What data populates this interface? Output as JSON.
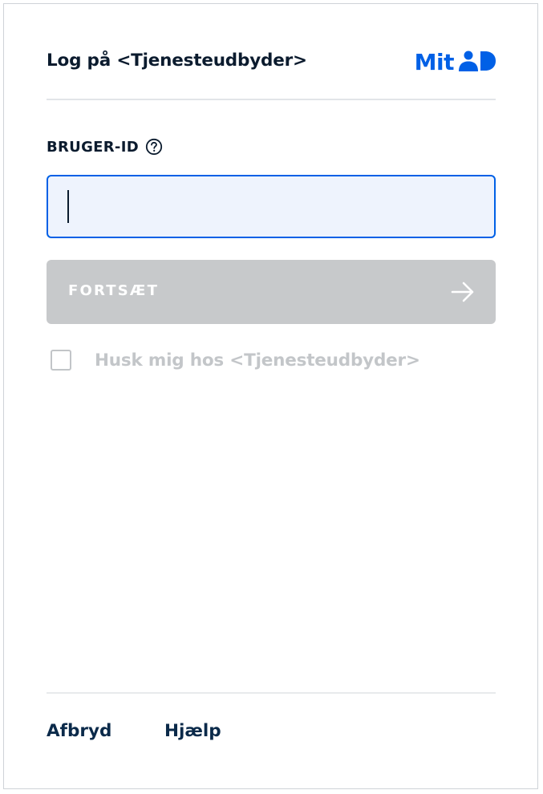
{
  "header": {
    "title": "Log på <Tjenesteudbyder>",
    "logo_text": "Mit",
    "logo_icon": "person-id-icon",
    "brand_color": "#0060e6"
  },
  "form": {
    "field_label": "BRUGER-ID",
    "help_icon": "question-circle-icon",
    "user_id_value": "",
    "continue_label": "FORTSÆT",
    "continue_icon": "arrow-right-icon",
    "continue_disabled_color": "#c7c9cb",
    "remember_label": "Husk mig hos <Tjenesteudbyder>",
    "remember_checked": false
  },
  "footer": {
    "cancel_label": "Afbryd",
    "help_label": "Hjælp"
  }
}
